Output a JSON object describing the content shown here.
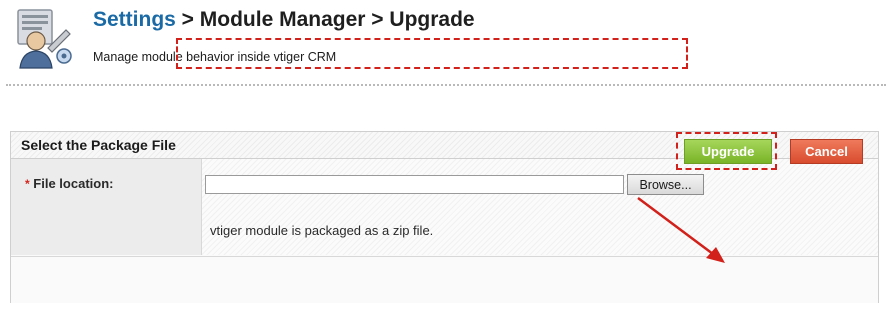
{
  "header": {
    "breadcrumb": {
      "root": "Settings",
      "separator1": " > ",
      "module": "Module Manager",
      "separator2": " > ",
      "page": "Upgrade"
    },
    "subtitle": "Manage module behavior inside vtiger CRM",
    "icon": "settings-user-tools-icon"
  },
  "panel": {
    "title": "Select the Package File",
    "field": {
      "required_marker": "*",
      "label": "File location:",
      "value": "",
      "placeholder": "",
      "browse_label": "Browse...",
      "help_text": "vtiger module is packaged as a zip file."
    },
    "actions": {
      "upgrade_label": "Upgrade",
      "cancel_label": "Cancel"
    }
  },
  "colors": {
    "link_blue": "#1a6aa6",
    "upgrade_green": "#8cc63f",
    "cancel_red": "#e05a3b",
    "annotation_red": "#d2201a"
  }
}
